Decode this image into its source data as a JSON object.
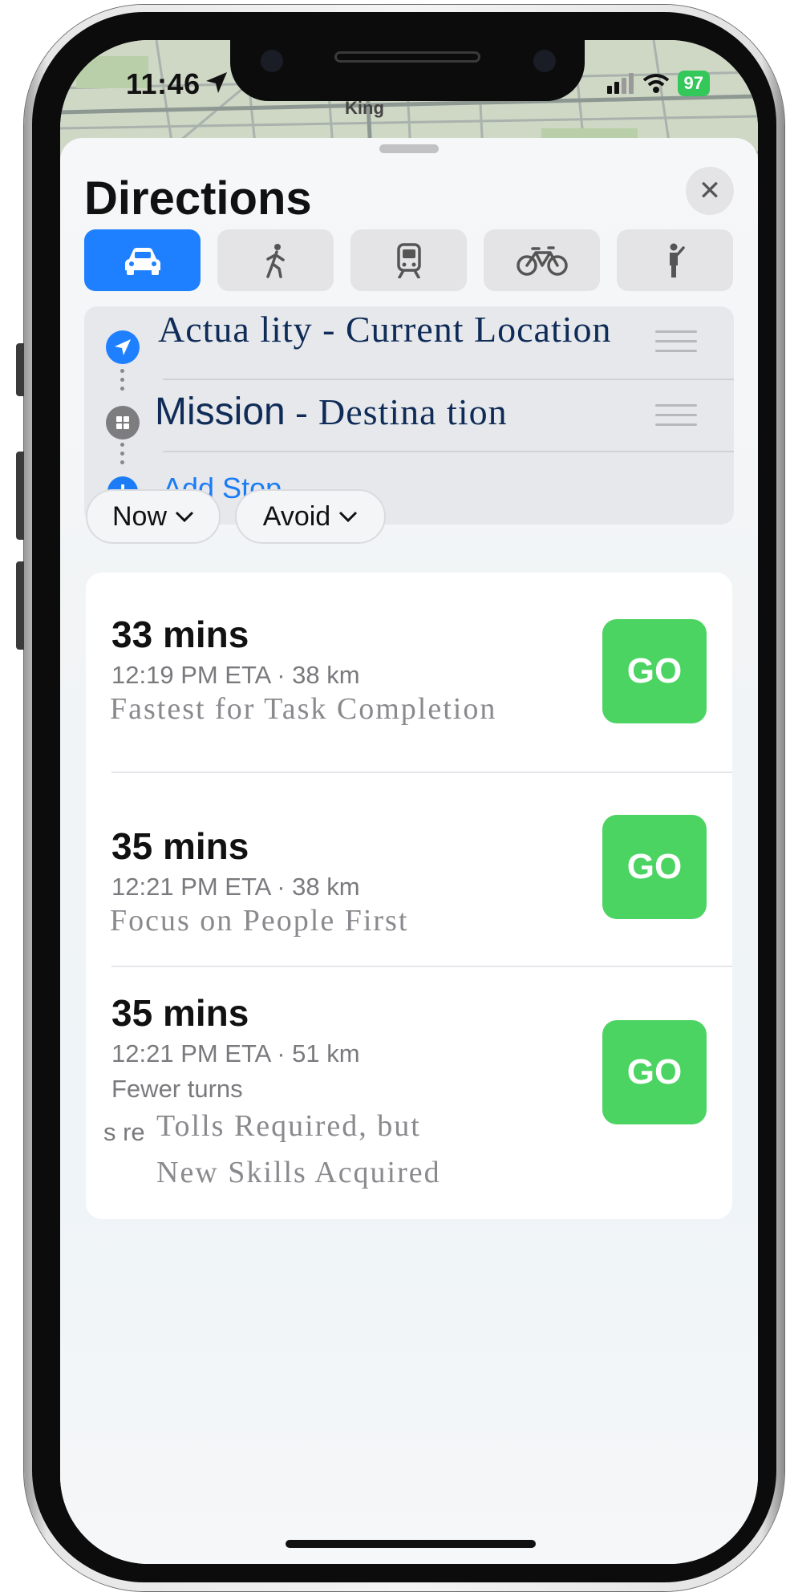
{
  "status_bar": {
    "time": "11:46",
    "battery": "97"
  },
  "map": {
    "place_label": "King"
  },
  "sheet": {
    "title": "Directions",
    "close_glyph": "✕",
    "transport_modes": [
      {
        "name": "car-icon",
        "active": true
      },
      {
        "name": "walk-icon",
        "active": false
      },
      {
        "name": "transit-icon",
        "active": false
      },
      {
        "name": "bike-icon",
        "active": false
      },
      {
        "name": "rideshare-icon",
        "active": false
      }
    ]
  },
  "stops": {
    "origin": "Actua lity - Current Location",
    "destination_prefix": "Mission",
    "destination_suffix": " - Destina tion",
    "add_stop": "Add Stop"
  },
  "filters": {
    "time": "Now",
    "avoid": "Avoid"
  },
  "routes": [
    {
      "duration": "33 mins",
      "eta": "12:19 PM ETA · 38 km",
      "note": "Fastest for Task Completion",
      "go": "GO"
    },
    {
      "duration": "35 mins",
      "eta": "12:21 PM ETA  ·  38 km",
      "note": "Focus on People First",
      "go": "GO"
    },
    {
      "duration": "35 mins",
      "eta": "12:21 PM ETA · 51 km",
      "note_a": "Fewer turns",
      "note_b_fragment": "s re",
      "note_c_line1": "Tolls Required, but",
      "note_c_line2": "New Skills Acquired",
      "go": "GO"
    }
  ],
  "colors": {
    "accent_blue": "#1e80ff",
    "go_green": "#4cd462",
    "text_navy": "#0f2b57"
  }
}
